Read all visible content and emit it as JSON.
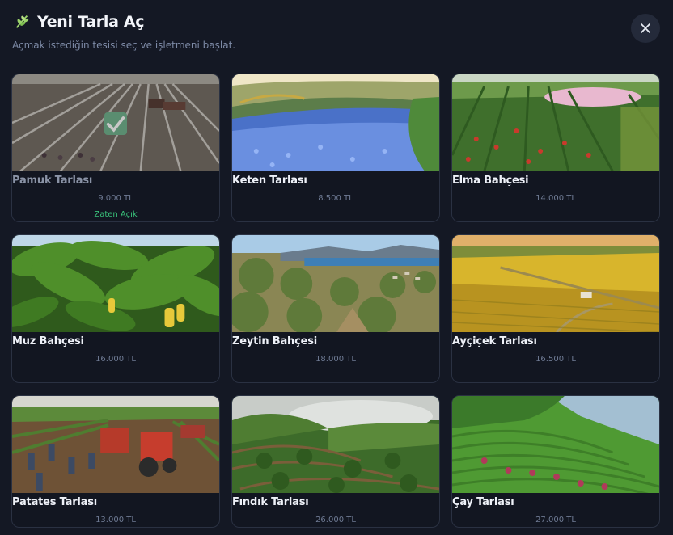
{
  "header": {
    "title": "Yeni Tarla Aç",
    "subtitle": "Açmak istediğin tesisi seç ve işletmeni başlat."
  },
  "colors": {
    "background": "#141824",
    "card": "#121621",
    "accent_green": "#39c27a",
    "price": "#6f7b94"
  },
  "fields": [
    {
      "name": "Pamuk Tarlası",
      "price": "9.000 TL",
      "status": "Zaten Açık",
      "owned": true,
      "image_icon": "cotton-field-image"
    },
    {
      "name": "Keten Tarlası",
      "price": "8.500 TL",
      "image_icon": "flax-field-image"
    },
    {
      "name": "Elma Bahçesi",
      "price": "14.000 TL",
      "image_icon": "apple-orchard-image"
    },
    {
      "name": "Muz Bahçesi",
      "price": "16.000 TL",
      "image_icon": "banana-plantation-image"
    },
    {
      "name": "Zeytin Bahçesi",
      "price": "18.000 TL",
      "image_icon": "olive-grove-image"
    },
    {
      "name": "Ayçiçek Tarlası",
      "price": "16.500 TL",
      "image_icon": "sunflower-field-image"
    },
    {
      "name": "Patates Tarlası",
      "price": "13.000 TL",
      "image_icon": "potato-field-image"
    },
    {
      "name": "Fındık Tarlası",
      "price": "26.000 TL",
      "image_icon": "hazelnut-field-image"
    },
    {
      "name": "Çay Tarlası",
      "price": "27.000 TL",
      "image_icon": "tea-plantation-image"
    }
  ]
}
